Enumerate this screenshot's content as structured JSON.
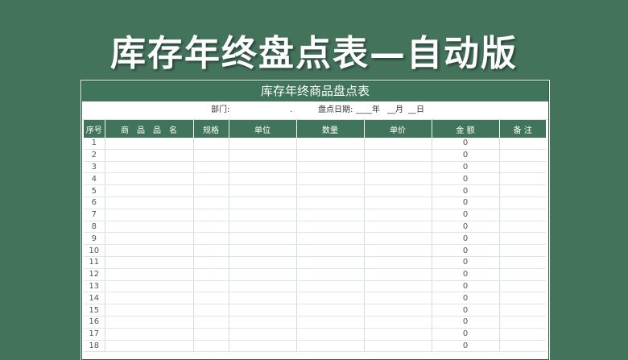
{
  "banner": {
    "title": "库存年终盘点表—自动版"
  },
  "sheet": {
    "title": "库存年终商品盘点表",
    "dept_label": "部门:",
    "dept_dot": ".",
    "date_label": "盘点日期:",
    "date_year": "____年",
    "date_month": "__月",
    "date_day": "__日"
  },
  "table": {
    "headers": [
      "序号",
      "商　品　品　名",
      "规格",
      "单位",
      "数量",
      "单价",
      "金 额",
      "备 注"
    ],
    "rows": [
      {
        "no": "1",
        "amount": "0"
      },
      {
        "no": "2",
        "amount": "0"
      },
      {
        "no": "3",
        "amount": "0"
      },
      {
        "no": "4",
        "amount": "0"
      },
      {
        "no": "5",
        "amount": "0"
      },
      {
        "no": "6",
        "amount": "0"
      },
      {
        "no": "7",
        "amount": "0"
      },
      {
        "no": "8",
        "amount": "0"
      },
      {
        "no": "9",
        "amount": "0"
      },
      {
        "no": "10",
        "amount": "0"
      },
      {
        "no": "11",
        "amount": "0"
      },
      {
        "no": "12",
        "amount": "0"
      },
      {
        "no": "13",
        "amount": "0"
      },
      {
        "no": "14",
        "amount": "0"
      },
      {
        "no": "15",
        "amount": "0"
      },
      {
        "no": "16",
        "amount": "0"
      },
      {
        "no": "17",
        "amount": "0"
      },
      {
        "no": "18",
        "amount": "0"
      }
    ]
  }
}
